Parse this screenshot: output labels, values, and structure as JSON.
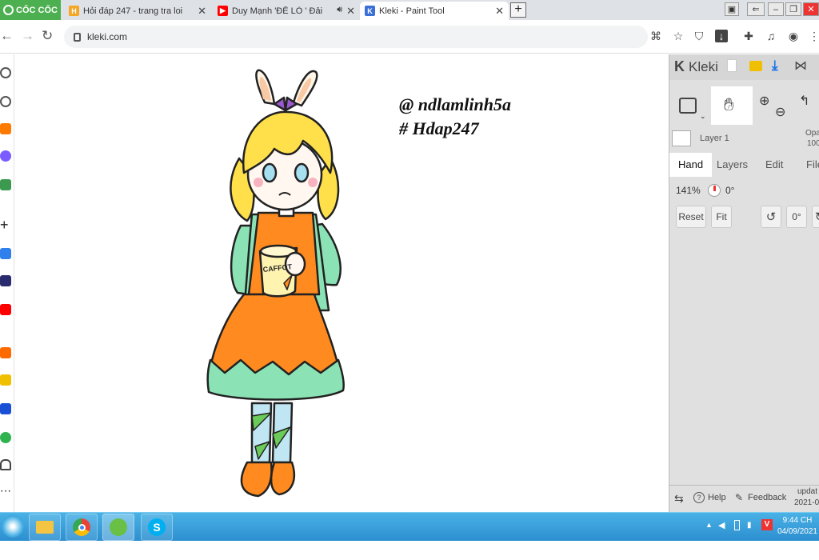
{
  "browser": {
    "brand": "CỐC CỐC",
    "tabs": [
      {
        "title": "Hỏi đáp 247 - trang tra loi",
        "favicon_color": "#f5a623"
      },
      {
        "title": "Duy Mạnh 'ĐẾ LỎ ' Đải",
        "favicon_color": "#ff0000"
      },
      {
        "title": "Kleki - Paint Tool",
        "favicon_color": "#3a6fd8"
      }
    ],
    "new_tab": "+",
    "url": "kleki.com"
  },
  "canvas": {
    "caption_line1": "@ ndlamlinh5a",
    "caption_line2": "# Hdap247",
    "drawing_label": "CAFFOT"
  },
  "kleki": {
    "title": "Kleki",
    "layer_name": "Layer 1",
    "opacity_label": "Opa",
    "opacity_value": "100",
    "tabs": [
      "Hand",
      "Layers",
      "Edit",
      "File"
    ],
    "zoom": "141%",
    "rotation": "0°",
    "buttons": {
      "reset": "Reset",
      "fit": "Fit",
      "angle": "0°"
    },
    "footer": {
      "help": "Help",
      "feedback": "Feedback",
      "update_line1": "updat",
      "update_line2": "2021-0"
    }
  },
  "taskbar": {
    "time": "9:44 CH",
    "date": "04/09/2021"
  },
  "colors": {
    "accent_green": "#4caf50",
    "taskbar": "#2c8fd0",
    "download_blue": "#1a73e8"
  }
}
